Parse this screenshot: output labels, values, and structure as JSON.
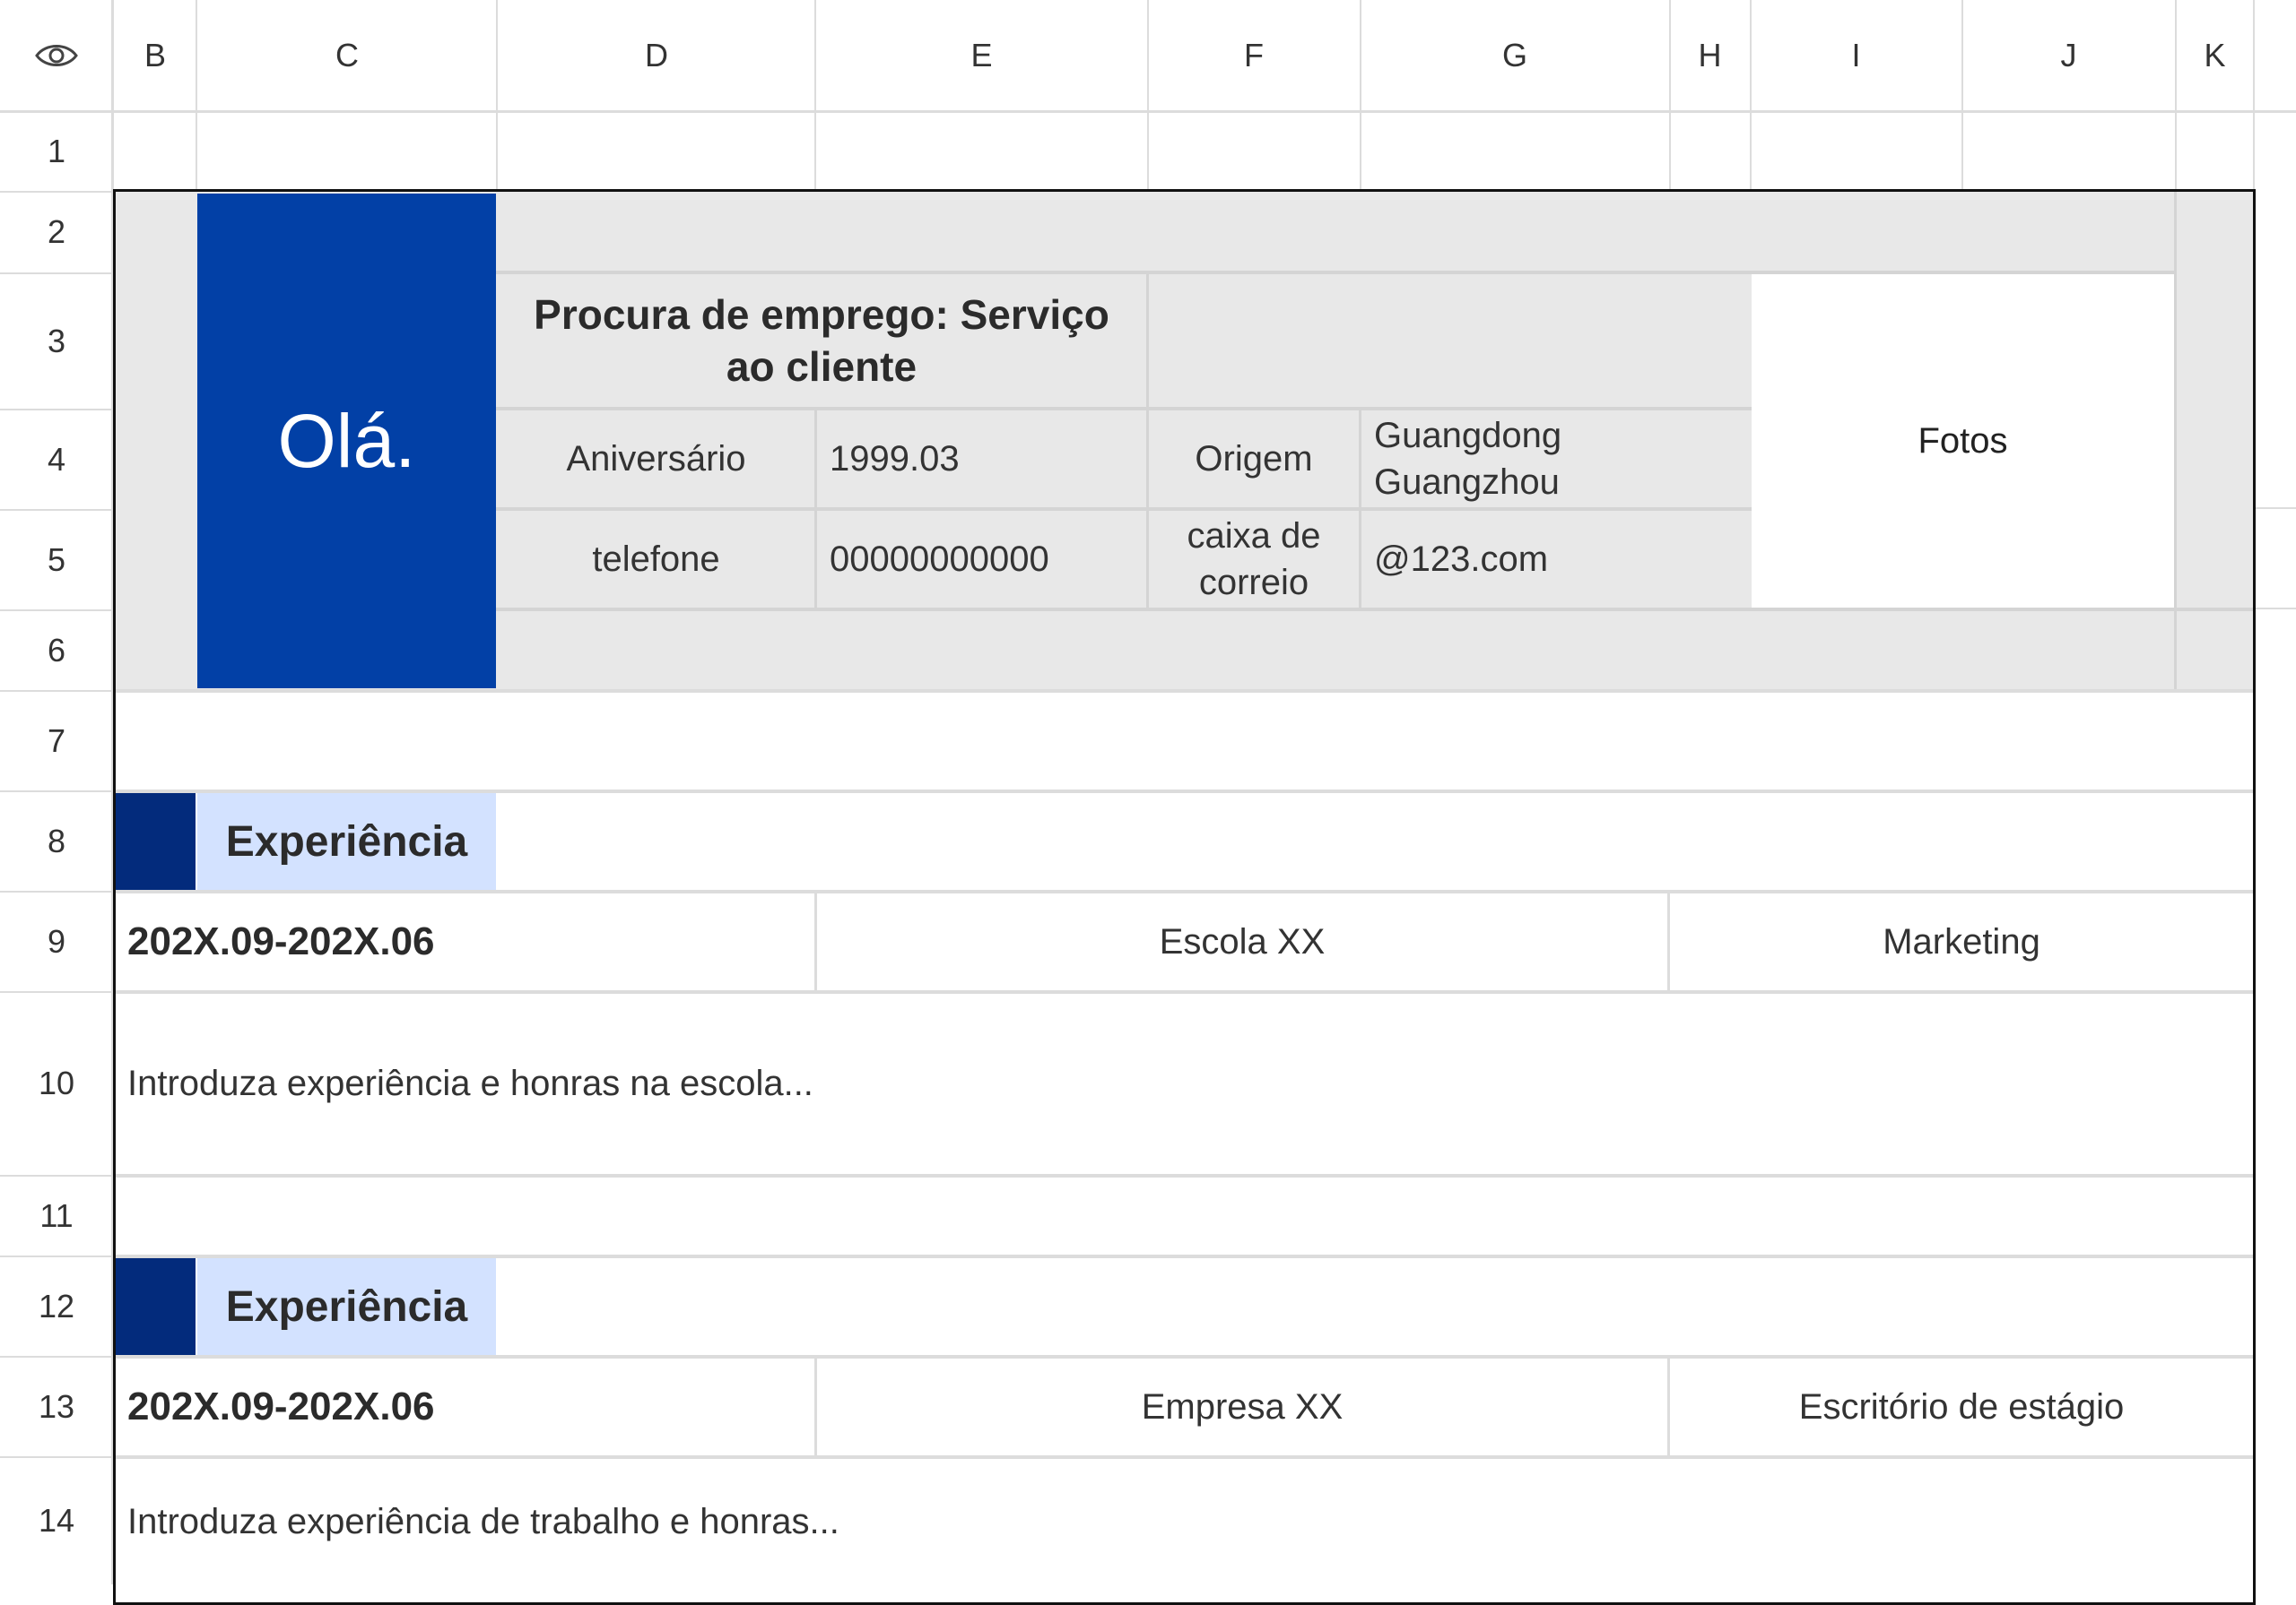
{
  "columns": [
    "B",
    "C",
    "D",
    "E",
    "F",
    "G",
    "H",
    "I",
    "J",
    "K"
  ],
  "rows": [
    "1",
    "2",
    "3",
    "4",
    "5",
    "6",
    "7",
    "8",
    "9",
    "10",
    "11",
    "12",
    "13",
    "14"
  ],
  "colors": {
    "blue_dark": "#0240A6",
    "navy": "#032B7C",
    "light_blue": "#D3E2FF",
    "gray_bg": "#E8E8E8",
    "grid": "#DCDCDC"
  },
  "header": {
    "greeting": "Olá.",
    "job_title": "Procura de emprego: Serviço ao cliente",
    "birthday_label": "Aniversário",
    "birthday_value": "1999.03",
    "origin_label": "Origem",
    "origin_value": "Guangdong Guangzhou",
    "phone_label": "telefone",
    "phone_value": "00000000000",
    "mail_label": "caixa de correio",
    "mail_value": "@123.com",
    "photo_label": "Fotos"
  },
  "sections": [
    {
      "title": "Experiência",
      "period": "202X.09-202X.06",
      "place": "Escola XX",
      "role": "Marketing",
      "description": "Introduza experiência e honras na escola..."
    },
    {
      "title": "Experiência",
      "period": "202X.09-202X.06",
      "place": "Empresa XX",
      "role": "Escritório de estágio",
      "description": "Introduza experiência de trabalho e honras..."
    }
  ]
}
